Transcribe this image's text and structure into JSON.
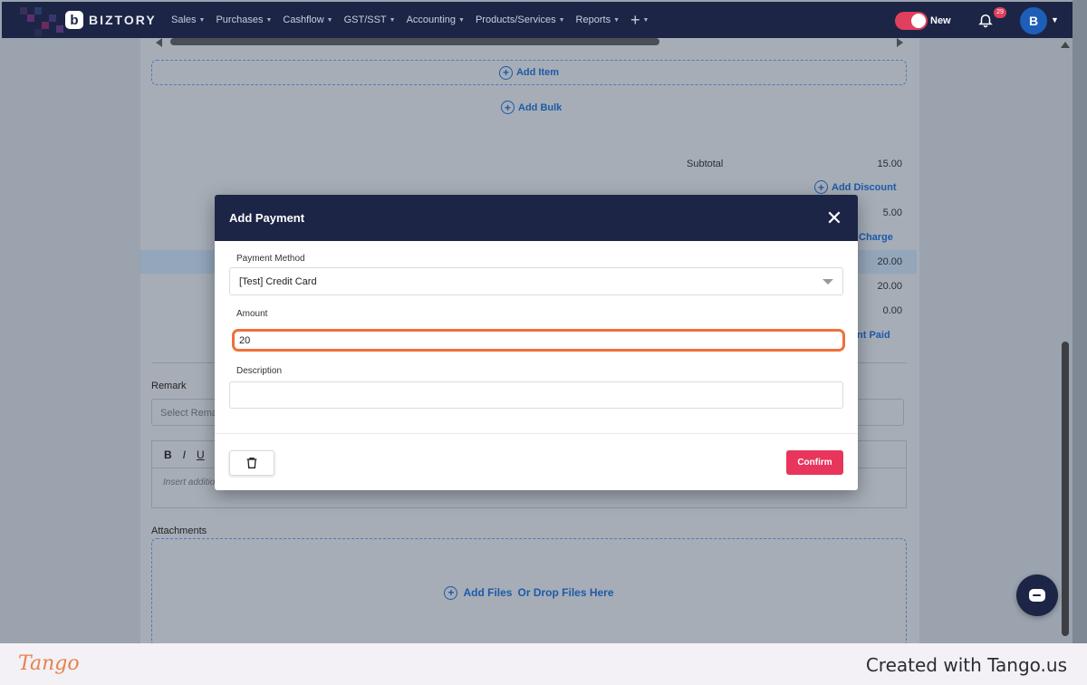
{
  "navbar": {
    "brand": "BIZTORY",
    "brand_mark": "b",
    "menu": [
      {
        "label": "Sales"
      },
      {
        "label": "Purchases"
      },
      {
        "label": "Cashflow"
      },
      {
        "label": "GST/SST"
      },
      {
        "label": "Accounting"
      },
      {
        "label": "Products/Services"
      },
      {
        "label": "Reports"
      }
    ],
    "plus_glyph": "+",
    "toggle_label": "New",
    "notification_count": "29",
    "avatar_initial": "B",
    "accent_color": "#1c2545"
  },
  "page": {
    "add_item": "Add Item",
    "add_bulk": "Add Bulk",
    "subtotal_label": "Subtotal",
    "subtotal_value": "15.00",
    "add_discount": "Add Discount",
    "tax_value": "5.00",
    "charge_link": "Charge",
    "total_value": "20.00",
    "paid_value": "20.00",
    "balance_value": "0.00",
    "paid_link": "nt Paid",
    "remark_label": "Remark",
    "remark_placeholder": "Select Rema",
    "editor_bold": "B",
    "editor_italic": "I",
    "editor_underline": "U",
    "editor_placeholder": "Insert additio",
    "attachments_label": "Attachments",
    "add_files": "Add Files",
    "drop_files": "Or Drop Files Here"
  },
  "modal": {
    "title": "Add Payment",
    "close_glyph": "✕",
    "payment_method_label": "Payment Method",
    "payment_method_value": "[Test] Credit Card",
    "amount_label": "Amount",
    "amount_value": "20",
    "description_label": "Description",
    "description_value": "",
    "confirm_label": "Confirm",
    "confirm_color": "#e8355b"
  },
  "footer": {
    "tango_logo": "Tango",
    "created_with": "Created with Tango.us"
  }
}
